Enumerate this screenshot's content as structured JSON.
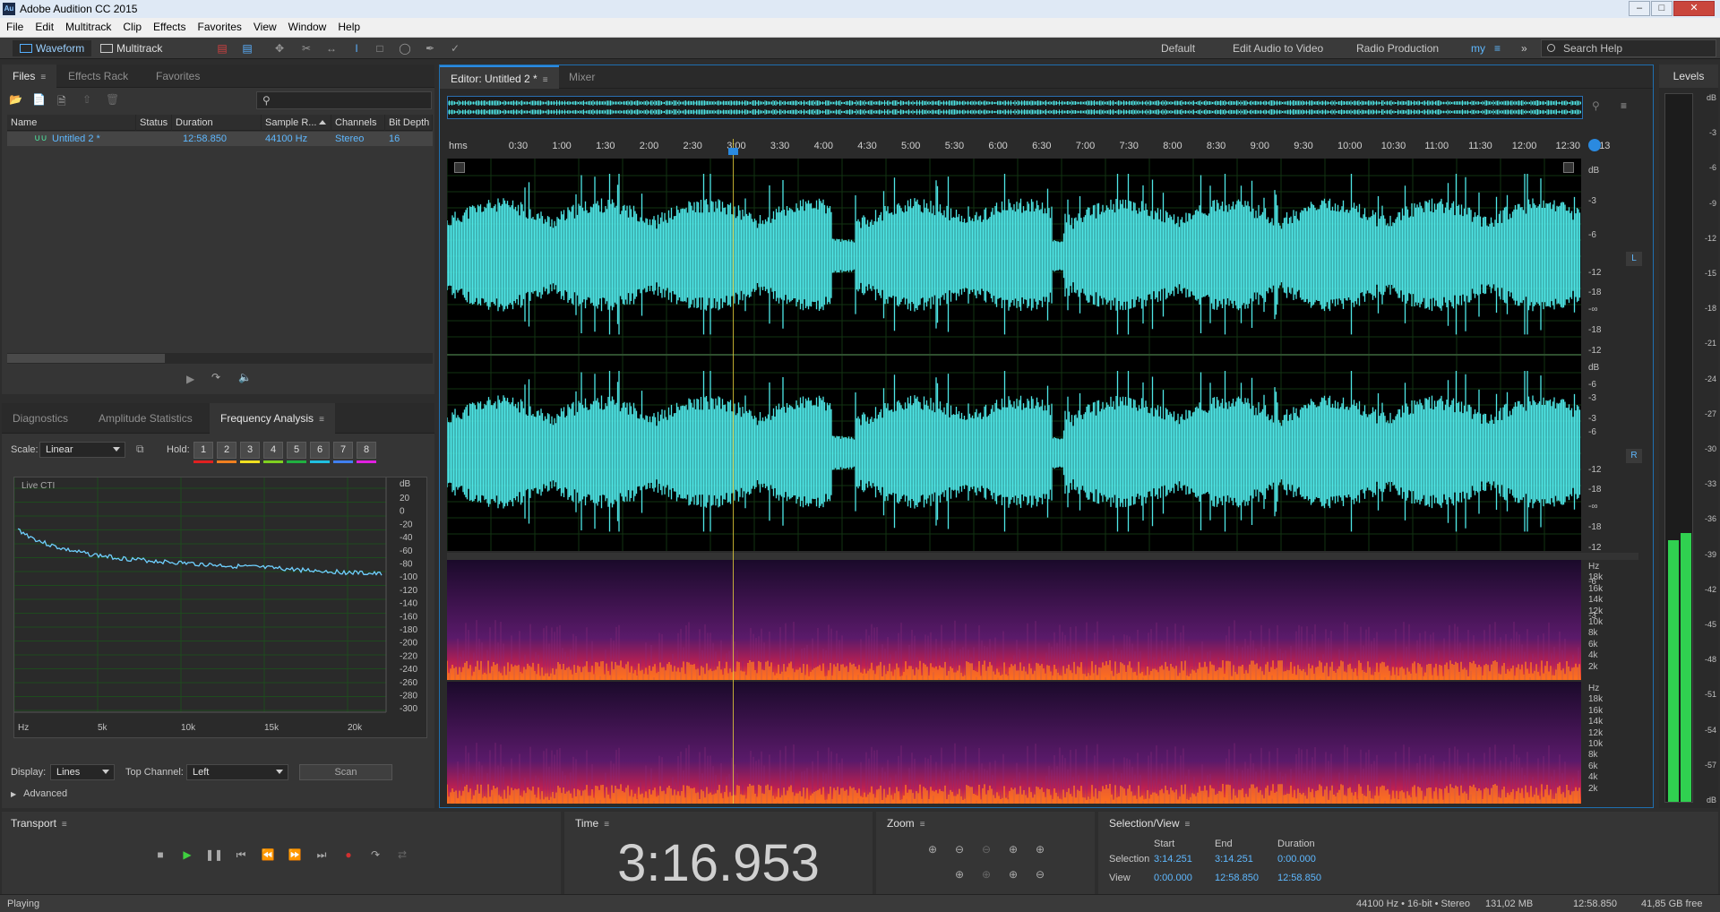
{
  "app": {
    "title": "Adobe Audition CC 2015",
    "icon_text": "Au"
  },
  "menu": [
    "File",
    "Edit",
    "Multitrack",
    "Clip",
    "Effects",
    "Favorites",
    "View",
    "Window",
    "Help"
  ],
  "toolbar": {
    "waveform_label": "Waveform",
    "multitrack_label": "Multitrack",
    "workspaces": [
      "Default",
      "Edit Audio to Video",
      "Radio Production",
      "my"
    ],
    "search_placeholder": "Search Help"
  },
  "files_panel": {
    "tabs": [
      "Files",
      "Effects Rack",
      "Favorites"
    ],
    "columns": [
      "Name",
      "Status",
      "Duration",
      "Sample R...",
      "Channels",
      "Bit Depth"
    ],
    "rows": [
      {
        "name": "Untitled 2 *",
        "status": "",
        "duration": "12:58.850",
        "sample_rate": "44100 Hz",
        "channels": "Stereo",
        "bit_depth": "16"
      }
    ]
  },
  "analysis_panel": {
    "tabs": [
      "Diagnostics",
      "Amplitude Statistics",
      "Frequency Analysis"
    ],
    "scale_label": "Scale:",
    "scale_value": "Linear",
    "hold_label": "Hold:",
    "hold_buttons": [
      "1",
      "2",
      "3",
      "4",
      "5",
      "6",
      "7",
      "8"
    ],
    "hold_colors": [
      "#e02020",
      "#f08020",
      "#f0e020",
      "#80d020",
      "#20b040",
      "#20c0e0",
      "#4080f0",
      "#e020e0"
    ],
    "graph_label": "Live CTI",
    "db_unit": "dB",
    "db_ticks": [
      "20",
      "0",
      "-20",
      "-40",
      "-60",
      "-80",
      "-100",
      "-120",
      "-140",
      "-160",
      "-180",
      "-200",
      "-220",
      "-240",
      "-260",
      "-280",
      "-300"
    ],
    "hz_ticks": [
      "Hz",
      "5k",
      "10k",
      "15k",
      "20k"
    ],
    "display_label": "Display:",
    "display_value": "Lines",
    "top_channel_label": "Top Channel:",
    "top_channel_value": "Left",
    "scan_label": "Scan",
    "advanced_label": "Advanced"
  },
  "editor": {
    "tabs": [
      "Editor: Untitled 2 *",
      "Mixer"
    ],
    "ruler_ticks": [
      "hms",
      "0:30",
      "1:00",
      "1:30",
      "2:00",
      "2:30",
      "3:00",
      "3:30",
      "4:00",
      "4:30",
      "5:00",
      "5:30",
      "6:00",
      "6:30",
      "7:00",
      "7:30",
      "8:00",
      "8:30",
      "9:00",
      "9:30",
      "10:00",
      "10:30",
      "11:00",
      "11:30",
      "12:00",
      "12:30",
      "13"
    ],
    "db_labels_top": [
      "dB",
      "-3",
      "-6",
      "-12",
      "-18",
      "-∞",
      "-18",
      "-12",
      "-6",
      "-3"
    ],
    "db_labels_bottom": [
      "dB",
      "-3",
      "-6",
      "-12",
      "-18",
      "-∞",
      "-18",
      "-12",
      "-6",
      "-3"
    ],
    "hz_labels": [
      "Hz",
      "18k",
      "16k",
      "14k",
      "12k",
      "10k",
      "8k",
      "6k",
      "4k",
      "2k"
    ],
    "channel_left": "L",
    "channel_right": "R",
    "waveform_color": "#4ee6e6"
  },
  "levels": {
    "title": "Levels",
    "ticks": [
      "dB",
      "-3",
      "-6",
      "-9",
      "-12",
      "-15",
      "-18",
      "-21",
      "-24",
      "-27",
      "-30",
      "-33",
      "-36",
      "-39",
      "-42",
      "-45",
      "-48",
      "-51",
      "-54",
      "-57",
      "dB"
    ],
    "left_level": 0.37,
    "right_level": 0.38
  },
  "transport": {
    "title": "Transport"
  },
  "time": {
    "title": "Time",
    "value": "3:16.953"
  },
  "zoom": {
    "title": "Zoom"
  },
  "selection": {
    "title": "Selection/View",
    "headers": [
      "Start",
      "End",
      "Duration"
    ],
    "selection_label": "Selection",
    "view_label": "View",
    "selection_values": [
      "3:14.251",
      "3:14.251",
      "0:00.000"
    ],
    "view_values": [
      "0:00.000",
      "12:58.850",
      "12:58.850"
    ]
  },
  "status": {
    "left": "Playing",
    "format": "44100 Hz • 16-bit • Stereo",
    "size": "131,02 MB",
    "duration": "12:58.850",
    "free": "41,85 GB free"
  }
}
